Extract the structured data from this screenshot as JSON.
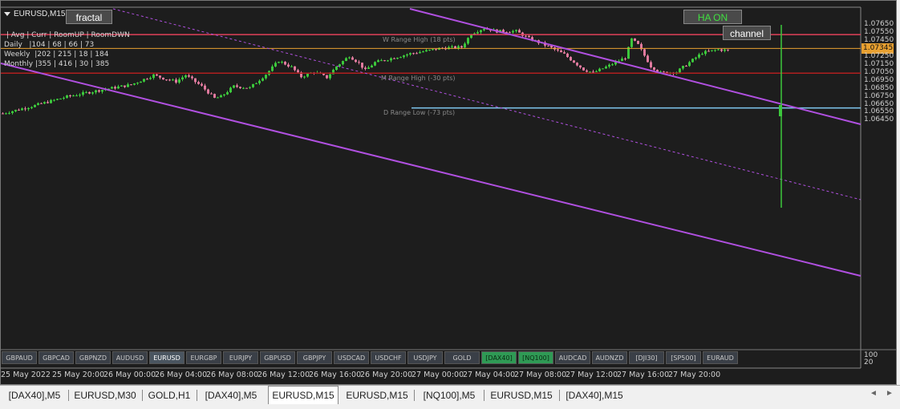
{
  "window": {
    "symbol_title": "EURUSD,M15"
  },
  "buttons": {
    "fractal": "fractal",
    "ha_on": "HA ON",
    "channel": "channel"
  },
  "stats": {
    "header": " | Avg | Curr | RoomUP | RoomDWN",
    "rows": [
      "Daily   |104 | 68 | 66 | 73",
      "Weekly  |202 | 215 | 18 | 184",
      "Monthly |355 | 416 | 30 | 385"
    ]
  },
  "levels": {
    "w_range_high": {
      "label": "W Range High (18 pts)",
      "price": 1.07528,
      "color": "#E0405A"
    },
    "m_range_high": {
      "label": "M Range High (-30 pts)",
      "price": 1.07045,
      "color": "#B02020"
    },
    "d_range_low": {
      "label": "D Range Low (-73 pts)",
      "price": 1.06608,
      "color": "#7FC8F0"
    },
    "current": {
      "label": "1.07345",
      "price": 1.07355,
      "color": "#E8A030"
    }
  },
  "colors": {
    "bull": "#3CC83C",
    "bear": "#E07A9E",
    "channel": "#B050E0",
    "background": "#1D1D1D"
  },
  "chart_data": {
    "type": "candlestick",
    "symbol": "EURUSD",
    "timeframe": "M15",
    "ylim": [
      1.0641,
      1.0771
    ],
    "y_ticks": [
      "1.07650",
      "1.07550",
      "1.07450",
      "1.07345",
      "1.07250",
      "1.07150",
      "1.07050",
      "1.06950",
      "1.06850",
      "1.06750",
      "1.06650",
      "1.06550",
      "1.06450"
    ],
    "x_ticks": [
      "25 May 2022",
      "25 May 20:00",
      "26 May 00:00",
      "26 May 04:00",
      "26 May 08:00",
      "26 May 12:00",
      "26 May 16:00",
      "26 May 20:00",
      "27 May 00:00",
      "27 May 04:00",
      "27 May 08:00",
      "27 May 12:00",
      "27 May 16:00",
      "27 May 20:00"
    ],
    "keypoints": [
      [
        0,
        1.0654
      ],
      [
        10,
        1.0664
      ],
      [
        20,
        1.0675
      ],
      [
        30,
        1.0683
      ],
      [
        40,
        1.069
      ],
      [
        47,
        1.0702
      ],
      [
        50,
        1.0698
      ],
      [
        54,
        1.0694
      ],
      [
        57,
        1.0702
      ],
      [
        62,
        1.0688
      ],
      [
        66,
        1.0673
      ],
      [
        68,
        1.0675
      ],
      [
        72,
        1.0688
      ],
      [
        77,
        1.0686
      ],
      [
        82,
        1.0703
      ],
      [
        86,
        1.072
      ],
      [
        90,
        1.0712
      ],
      [
        93,
        1.07
      ],
      [
        97,
        1.0706
      ],
      [
        101,
        1.0699
      ],
      [
        104,
        1.0713
      ],
      [
        108,
        1.0726
      ],
      [
        111,
        1.0717
      ],
      [
        113,
        1.0708
      ],
      [
        116,
        1.0718
      ],
      [
        121,
        1.0723
      ],
      [
        127,
        1.0729
      ],
      [
        133,
        1.0733
      ],
      [
        137,
        1.0736
      ],
      [
        143,
        1.0737
      ],
      [
        146,
        1.0754
      ],
      [
        150,
        1.0761
      ],
      [
        154,
        1.0757
      ],
      [
        160,
        1.0757
      ],
      [
        164,
        1.0748
      ],
      [
        170,
        1.0738
      ],
      [
        175,
        1.0728
      ],
      [
        181,
        1.0709
      ],
      [
        184,
        1.0705
      ],
      [
        189,
        1.0714
      ],
      [
        194,
        1.0724
      ],
      [
        196,
        1.0747
      ],
      [
        198,
        1.074
      ],
      [
        202,
        1.0713
      ],
      [
        205,
        1.0705
      ],
      [
        210,
        1.0706
      ],
      [
        214,
        1.0718
      ],
      [
        218,
        1.073
      ],
      [
        223,
        1.0734
      ],
      [
        226,
        1.0733
      ]
    ],
    "sub_window": {
      "label_top": "100",
      "label_bottom": "20",
      "symbols": [
        "GBPAUD",
        "GBPCAD",
        "GBPNZD",
        "AUDUSD",
        "EURUSD",
        "EURGBP",
        "EURJPY",
        "GBPUSD",
        "GBPJPY",
        "USDCAD",
        "USDCHF",
        "USDJPY",
        "GOLD",
        "[DAX40]",
        "[NQ100]",
        "AUDCAD",
        "AUDNZD",
        "[DJI30]",
        "[SP500]",
        "EURAUD"
      ],
      "active": "EURUSD",
      "green": [
        "[DAX40]",
        "[NQ100]"
      ]
    }
  },
  "tabs": {
    "items": [
      "[DAX40],M5",
      "EURUSD,M30",
      "GOLD,H1",
      "[DAX40],M5",
      "EURUSD,M15",
      "EURUSD,M15",
      "[NQ100],M5",
      "EURUSD,M15",
      "[DAX40],M15"
    ],
    "active_index": 4,
    "prev": "◄",
    "next": "►"
  }
}
